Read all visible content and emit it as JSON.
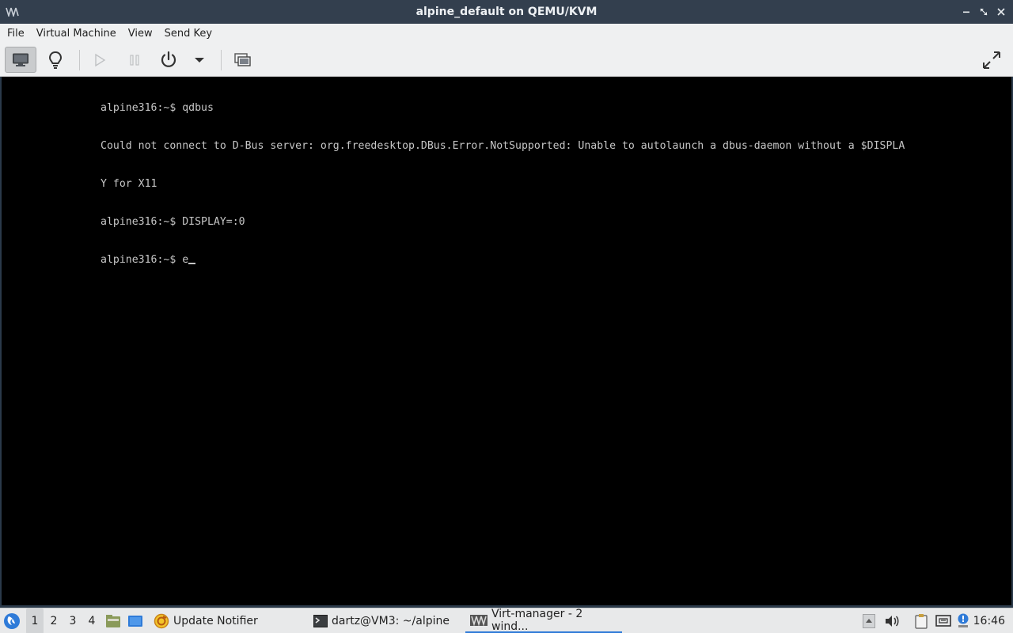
{
  "window": {
    "title": "alpine_default on QEMU/KVM",
    "app_icon": "virt-manager-icon",
    "controls": {
      "minimize": "‒",
      "maximize": "⤢",
      "close": "✕"
    }
  },
  "menubar": {
    "items": [
      "File",
      "Virtual Machine",
      "View",
      "Send Key"
    ]
  },
  "toolbar": {
    "buttons": [
      {
        "name": "console-view",
        "icon": "monitor-icon"
      },
      {
        "name": "details-view",
        "icon": "lightbulb-icon"
      },
      {
        "name": "run",
        "icon": "play-icon"
      },
      {
        "name": "pause",
        "icon": "pause-icon"
      },
      {
        "name": "power",
        "icon": "power-icon"
      },
      {
        "name": "power-menu",
        "icon": "chevron-down-icon"
      },
      {
        "name": "snapshots",
        "icon": "snapshots-icon"
      },
      {
        "name": "fullscreen",
        "icon": "fullscreen-icon"
      }
    ]
  },
  "console": {
    "lines": [
      "alpine316:~$ qdbus",
      "Could not connect to D-Bus server: org.freedesktop.DBus.Error.NotSupported: Unable to autolaunch a dbus-daemon without a $DISPLA",
      "Y for X11",
      "alpine316:~$ DISPLAY=:0",
      "alpine316:~$ e"
    ]
  },
  "taskbar": {
    "workspaces": [
      "1",
      "2",
      "3",
      "4"
    ],
    "active_workspace": "1",
    "tasks": [
      {
        "label": "Update Notifier",
        "icon": "update-notifier-icon"
      },
      {
        "label": "dartz@VM3: ~/alpine",
        "icon": "terminal-icon"
      },
      {
        "label": "Virt-manager - 2 wind...",
        "icon": "virt-manager-icon",
        "active": true
      }
    ],
    "clock": "16:46"
  },
  "colors": {
    "titlebar": "#333f4e",
    "console_bg": "#000000",
    "console_text": "#c6c6c6",
    "accent": "#2f7bd8"
  }
}
